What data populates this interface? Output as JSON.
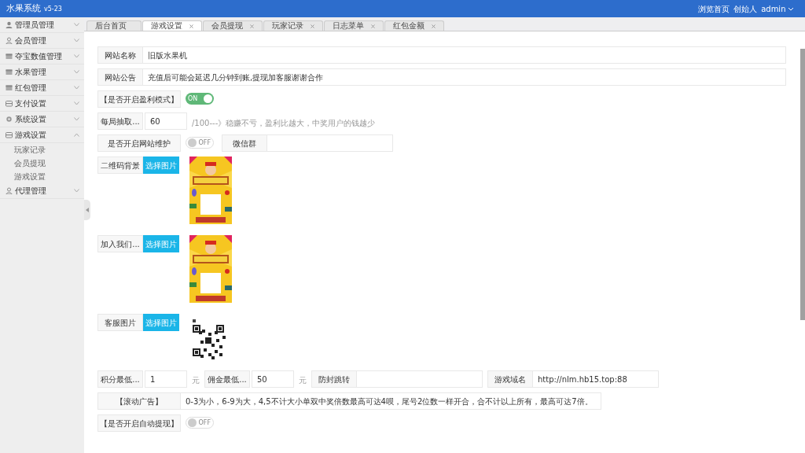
{
  "header": {
    "title": "水果系统",
    "version": "v5-23",
    "links": [
      "浏览首页",
      "创始人"
    ],
    "user": "admin"
  },
  "sidebar": {
    "items": [
      {
        "label": "管理员管理",
        "expanded": false
      },
      {
        "label": "会员管理",
        "expanded": false
      },
      {
        "label": "夺宝数值管理",
        "expanded": false
      },
      {
        "label": "水果管理",
        "expanded": false
      },
      {
        "label": "红包管理",
        "expanded": false
      },
      {
        "label": "支付设置",
        "expanded": false
      },
      {
        "label": "系统设置",
        "expanded": false
      },
      {
        "label": "游戏设置",
        "expanded": true,
        "children": [
          {
            "label": "玩家记录"
          },
          {
            "label": "会员提现"
          },
          {
            "label": "游戏设置"
          }
        ]
      },
      {
        "label": "代理管理",
        "expanded": false
      }
    ]
  },
  "tabs": [
    {
      "label": "后台首页",
      "selected": false,
      "closable": false
    },
    {
      "label": "游戏设置",
      "selected": true,
      "closable": true
    },
    {
      "label": "会员提现",
      "selected": false,
      "closable": true
    },
    {
      "label": "玩家记录",
      "selected": false,
      "closable": true
    },
    {
      "label": "日志菜单",
      "selected": false,
      "closable": true
    },
    {
      "label": "红包金额",
      "selected": false,
      "closable": true
    }
  ],
  "form_rows": [
    {
      "items": [
        {
          "kind": "label",
          "text": "网站名称"
        },
        {
          "kind": "wide-field",
          "value": "旧版水果机"
        }
      ]
    },
    {
      "items": [
        {
          "kind": "label",
          "text": "网站公告"
        },
        {
          "kind": "wide-field",
          "value": "充值后可能会延迟几分钟到账,提现加客服谢谢合作"
        }
      ]
    },
    {
      "items": [
        {
          "kind": "long-label",
          "text": "【是否开启盈利模式】"
        },
        {
          "kind": "toggle",
          "on": true,
          "text": "ON"
        }
      ]
    },
    {
      "items": [
        {
          "kind": "label",
          "text": "每局抽取..."
        },
        {
          "kind": "field",
          "value": "60"
        },
        {
          "kind": "hint",
          "text": "/100---》稳赚不亏，盈利比越大，中奖用户的钱越少"
        }
      ]
    },
    {
      "items": [
        {
          "kind": "long-label",
          "text": "是否开启网站维护"
        },
        {
          "kind": "toggle",
          "on": false,
          "text": "OFF"
        },
        {
          "kind": "label",
          "text": "微信群"
        },
        {
          "kind": "mid-field"
        }
      ]
    },
    {
      "items": [
        {
          "kind": "label",
          "text": "二维码背景"
        },
        {
          "kind": "button",
          "text": "选择图片"
        },
        {
          "kind": "poster"
        }
      ]
    },
    {
      "items": [
        {
          "kind": "label",
          "text": "加入我们..."
        },
        {
          "kind": "button",
          "text": "选择图片"
        },
        {
          "kind": "poster"
        }
      ]
    },
    {
      "items": [
        {
          "kind": "label",
          "text": "客服图片"
        },
        {
          "kind": "button",
          "text": "选择图片"
        },
        {
          "kind": "qr"
        }
      ]
    },
    {
      "items": [
        {
          "kind": "label",
          "text": "积分最低..."
        },
        {
          "kind": "field",
          "value": "1"
        },
        {
          "kind": "unit",
          "text": "元"
        },
        {
          "kind": "label",
          "text": "佣金最低..."
        },
        {
          "kind": "field",
          "value": "50"
        },
        {
          "kind": "unit",
          "text": "元"
        },
        {
          "kind": "label",
          "text": "防封跳转"
        },
        {
          "kind": "mid-field"
        },
        {
          "kind": "label",
          "text": "游戏域名"
        },
        {
          "kind": "mid-field",
          "value": "http://nlm.hb15.top:88"
        }
      ]
    },
    {
      "items": [
        {
          "kind": "long-label",
          "text": "【滚动广告】"
        },
        {
          "kind": "ad-field",
          "value": "0-3为小，6-9为大，4,5不计大小单双中奖倍数最高可达4呗，尾号2位数一样开合，合不计以上所有，最高可达7倍。"
        }
      ]
    },
    {
      "items": [
        {
          "kind": "long-label",
          "text": "【是否开启自动提现】"
        },
        {
          "kind": "toggle",
          "on": false,
          "text": "OFF"
        }
      ]
    }
  ]
}
